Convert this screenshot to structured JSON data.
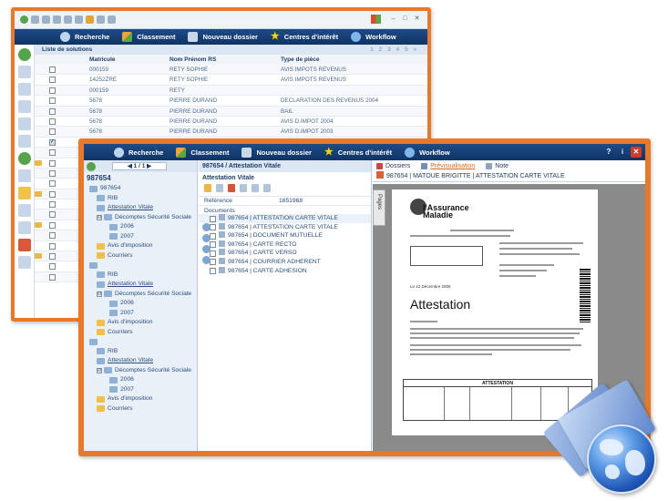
{
  "back_window": {
    "nav": [
      "Recherche",
      "Classement",
      "Nouveau dossier",
      "Centres d'intérêt",
      "Workflow"
    ],
    "list_title": "Liste de solutions",
    "pager": "1 2 3 4 5 »",
    "columns": [
      "Matricule",
      "Nom Prénom RS",
      "Type de pièce"
    ],
    "rows": [
      {
        "matricule": "000159",
        "nom": "RETY SOPHIE",
        "type": "AVIS IMPOTS REVENUS"
      },
      {
        "matricule": "14252ZRE",
        "nom": "RETY SOPHIE",
        "type": "AVIS IMPOTS REVENUS"
      },
      {
        "matricule": "000159",
        "nom": "RETY",
        "type": ""
      },
      {
        "matricule": "5678",
        "nom": "PIERRE DURAND",
        "type": "DECLARATION DES REVENUS 2004"
      },
      {
        "matricule": "5678",
        "nom": "PIERRE DURAND",
        "type": "BAIL"
      },
      {
        "matricule": "5678",
        "nom": "PIERRE DURAND",
        "type": "AVIS D.IMPOT 2004"
      },
      {
        "matricule": "5678",
        "nom": "PIERRE DURAND",
        "type": "AVIS D.IMPOT 2003"
      }
    ]
  },
  "front_window": {
    "nav": [
      "Recherche",
      "Classement",
      "Nouveau dossier",
      "Centres d'intérêt",
      "Workflow"
    ],
    "window_controls": [
      "?",
      "i",
      "✕"
    ],
    "pager": "◀   1 / 1   ▶",
    "record_id": "987654",
    "tree": [
      {
        "label": "987654",
        "level": 0,
        "kind": "folder"
      },
      {
        "label": "RIB",
        "level": 1,
        "kind": "doc"
      },
      {
        "label": "Attestation Vitale",
        "level": 1,
        "kind": "doc",
        "link": true
      },
      {
        "label": "Décomptes Sécurité Sociale",
        "level": 1,
        "kind": "folder",
        "toggle": "⊟"
      },
      {
        "label": "2006",
        "level": 2,
        "kind": "doc"
      },
      {
        "label": "2007",
        "level": 2,
        "kind": "doc"
      },
      {
        "label": "Avis d'imposition",
        "level": 1,
        "kind": "yfolder"
      },
      {
        "label": "Courriers",
        "level": 1,
        "kind": "yfolder"
      },
      {
        "label": "",
        "level": 0,
        "kind": "folder"
      },
      {
        "label": "RIB",
        "level": 1,
        "kind": "doc"
      },
      {
        "label": "Attestation Vitale",
        "level": 1,
        "kind": "doc",
        "link": true
      },
      {
        "label": "Décomptes Sécurité Sociale",
        "level": 1,
        "kind": "folder",
        "toggle": "⊟"
      },
      {
        "label": "2006",
        "level": 2,
        "kind": "doc"
      },
      {
        "label": "2007",
        "level": 2,
        "kind": "doc"
      },
      {
        "label": "Avis d'imposition",
        "level": 1,
        "kind": "yfolder"
      },
      {
        "label": "Courriers",
        "level": 1,
        "kind": "yfolder"
      },
      {
        "label": "",
        "level": 0,
        "kind": "folder"
      },
      {
        "label": "RIB",
        "level": 1,
        "kind": "doc"
      },
      {
        "label": "Attestation Vitale",
        "level": 1,
        "kind": "doc",
        "link": true
      },
      {
        "label": "Décomptes Sécurité Sociale",
        "level": 1,
        "kind": "folder",
        "toggle": "⊟"
      },
      {
        "label": "2006",
        "level": 2,
        "kind": "doc"
      },
      {
        "label": "2007",
        "level": 2,
        "kind": "doc"
      },
      {
        "label": "Avis d'imposition",
        "level": 1,
        "kind": "yfolder"
      },
      {
        "label": "Courriers",
        "level": 1,
        "kind": "yfolder"
      }
    ],
    "middle": {
      "header": "987654 / Attestation Vitale",
      "subtitle": "Attestation Vitale",
      "ref_label": "Référence",
      "ref_value": "1651968",
      "docs_label": "Documents",
      "documents": [
        "987654 | ATTESTATION CARTE VITALE",
        "987654 | ATTESTATION CARTE VITALE",
        "987654 | DOCUMENT MUTUELLE",
        "987654 | CARTE RECTO",
        "987654 | CARTE VERSO",
        "987654 | COURRIER ADHERENT",
        "987654 | CARTE ADHESION"
      ]
    },
    "right": {
      "tabs": [
        "Dossiers",
        "Prévisualisation",
        "Note"
      ],
      "doc_title": "987654 | MATOUE BRIGITTE | ATTESTATION CARTE VITALE",
      "pages_tab": "Pages",
      "preview": {
        "logo_text": "l'Assurance Maladie",
        "heading": "Attestation",
        "date_line": "Le 12 Décembre 2006",
        "table_header": "ATTESTATION"
      }
    }
  }
}
